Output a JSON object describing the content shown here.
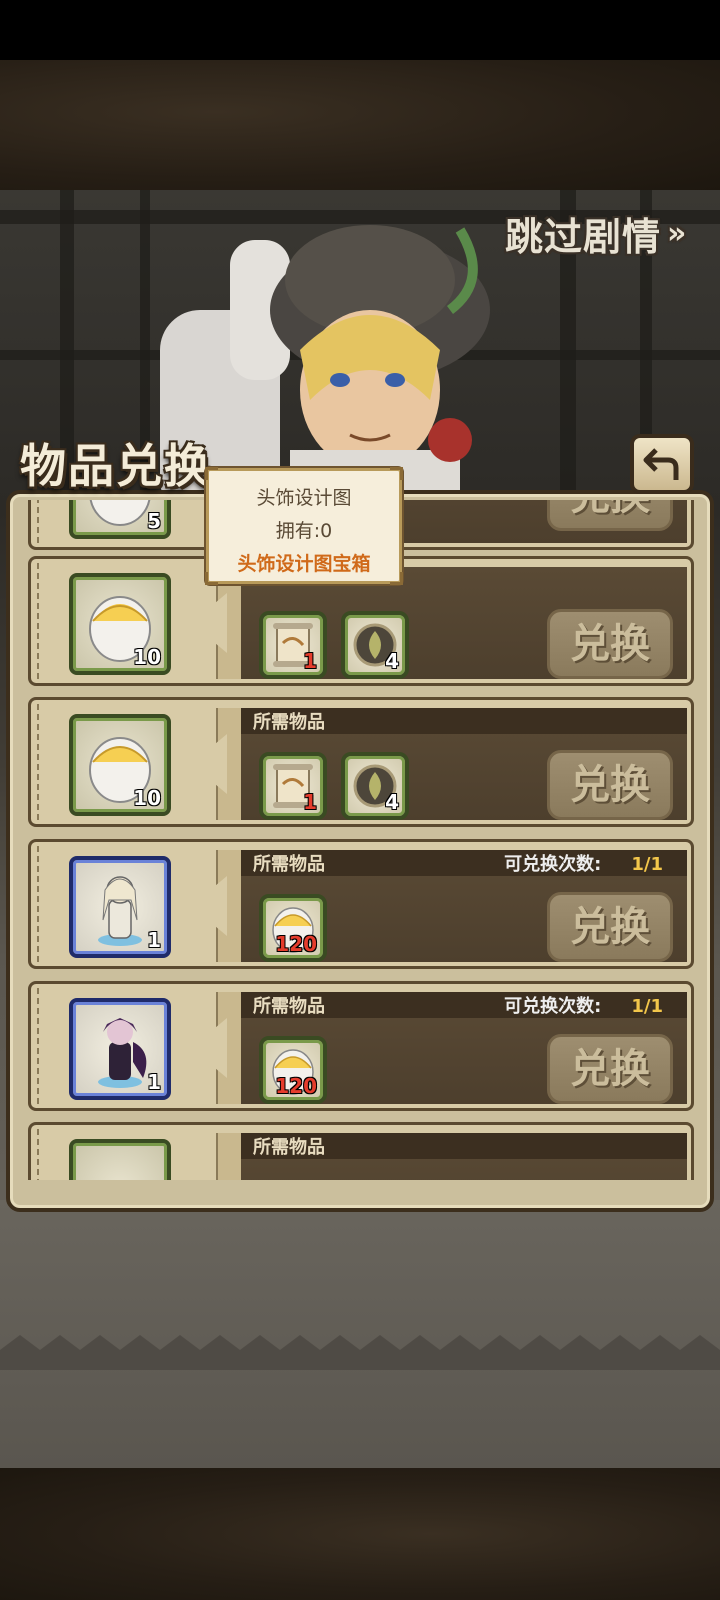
{
  "header": {
    "skip_label": "跳过剧情",
    "skip_arrow": "»"
  },
  "panel": {
    "title": "物品兑换",
    "back_icon": "return-arrow-icon"
  },
  "tooltip": {
    "item_name": "头饰设计图",
    "owned": "拥有:0",
    "source": "头饰设计图宝箱"
  },
  "rows": [
    {
      "reward_icon": "egg-icon",
      "reward_count": "5",
      "required_label": "所需物品",
      "exchange_label": "兑换"
    },
    {
      "reward_icon": "egg-icon",
      "reward_count": "10",
      "required_label": "所需物品",
      "req": [
        {
          "icon": "scroll-icon",
          "count": "1"
        },
        {
          "icon": "leaf-emblem-icon",
          "count": "4"
        }
      ],
      "exchange_label": "兑换"
    },
    {
      "reward_icon": "egg-icon",
      "reward_count": "10",
      "required_label": "所需物品",
      "req": [
        {
          "icon": "scroll-icon",
          "count": "1"
        },
        {
          "icon": "leaf-emblem-icon",
          "count": "4"
        }
      ],
      "exchange_label": "兑换"
    },
    {
      "reward_icon": "white-figure-icon",
      "reward_count": "1",
      "required_label": "所需物品",
      "limit_label": "可兑换次数:",
      "limit_value": "1/1",
      "req": [
        {
          "icon": "egg-icon",
          "count": "120"
        }
      ],
      "exchange_label": "兑换"
    },
    {
      "reward_icon": "dark-figure-icon",
      "reward_count": "1",
      "required_label": "所需物品",
      "limit_label": "可兑换次数:",
      "limit_value": "1/1",
      "req": [
        {
          "icon": "egg-icon",
          "count": "120"
        }
      ],
      "exchange_label": "兑换"
    },
    {
      "required_label": "所需物品"
    }
  ],
  "colors": {
    "highlight": "#f2c64b",
    "count_red": "#e53c2c",
    "tooltip_accent": "#d06a1a"
  }
}
